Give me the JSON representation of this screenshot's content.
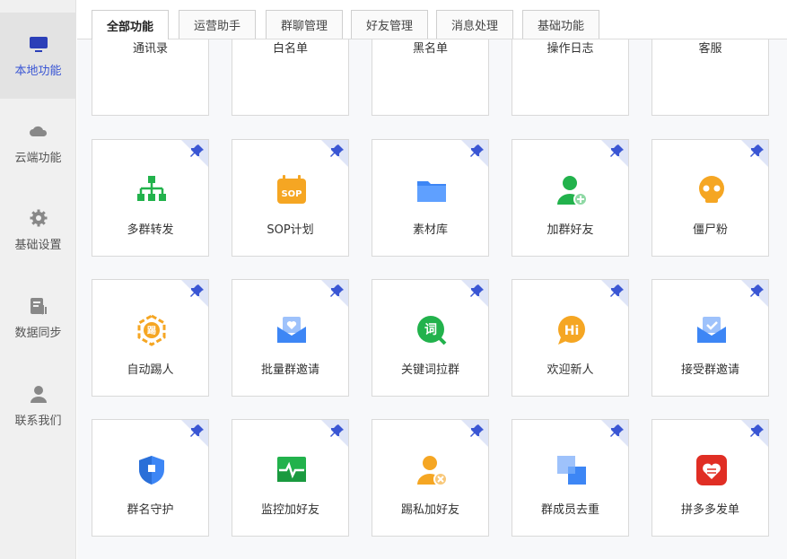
{
  "sidebar": {
    "items": [
      {
        "label": "本地功能",
        "icon": "monitor-icon"
      },
      {
        "label": "云端功能",
        "icon": "cloud-icon"
      },
      {
        "label": "基础设置",
        "icon": "gear-icon"
      },
      {
        "label": "数据同步",
        "icon": "sync-document-icon"
      },
      {
        "label": "联系我们",
        "icon": "user-icon"
      }
    ]
  },
  "tabs": [
    {
      "label": "全部功能"
    },
    {
      "label": "运营助手"
    },
    {
      "label": "群聊管理"
    },
    {
      "label": "好友管理"
    },
    {
      "label": "消息处理"
    },
    {
      "label": "基础功能"
    }
  ],
  "features": [
    {
      "label": "通讯录",
      "icon": "phonebook-icon"
    },
    {
      "label": "白名单",
      "icon": "user-check-icon"
    },
    {
      "label": "黑名单",
      "icon": "user-blocked-icon"
    },
    {
      "label": "操作日志",
      "icon": "log-book-icon"
    },
    {
      "label": "客服",
      "icon": "headset-icon"
    },
    {
      "label": "多群转发",
      "icon": "hierarchy-icon"
    },
    {
      "label": "SOP计划",
      "icon": "sop-calendar-icon"
    },
    {
      "label": "素材库",
      "icon": "folder-icon"
    },
    {
      "label": "加群好友",
      "icon": "user-add-icon"
    },
    {
      "label": "僵尸粉",
      "icon": "skull-icon"
    },
    {
      "label": "自动踢人",
      "icon": "auto-kick-icon"
    },
    {
      "label": "批量群邀请",
      "icon": "heart-mail-icon"
    },
    {
      "label": "关键词拉群",
      "icon": "keyword-icon"
    },
    {
      "label": "欢迎新人",
      "icon": "hi-bubble-icon"
    },
    {
      "label": "接受群邀请",
      "icon": "accept-mail-icon"
    },
    {
      "label": "群名守护",
      "icon": "shield-icon"
    },
    {
      "label": "监控加好友",
      "icon": "monitor-pulse-icon"
    },
    {
      "label": "踢私加好友",
      "icon": "user-remove-icon"
    },
    {
      "label": "群成员去重",
      "icon": "dedupe-icon"
    },
    {
      "label": "拼多多发单",
      "icon": "pinduoduo-icon"
    }
  ],
  "colors": {
    "accent": "#3a56d4",
    "green": "#22b24c",
    "orange": "#f5a623",
    "blue": "#3d86f5",
    "red": "#e02e24"
  }
}
